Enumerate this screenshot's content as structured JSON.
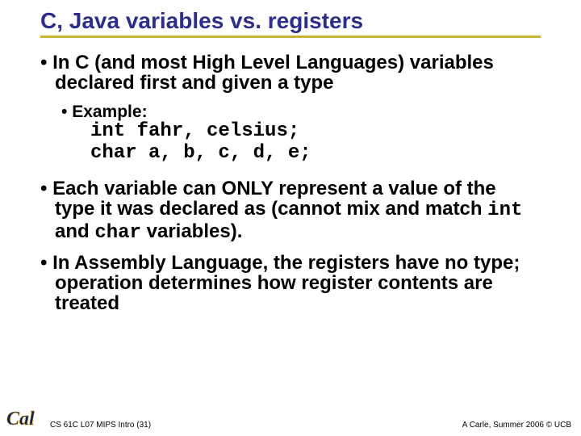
{
  "title": "C, Java variables vs. registers",
  "bullets": {
    "p1": "In C (and most High Level Languages) variables declared first and given a type",
    "example_label": "Example:",
    "code_line1": "int fahr, celsius;",
    "code_line2": "char a, b, c, d, e;",
    "p2_a": "Each variable can ONLY represent a value of the type it was declared as (cannot mix and match ",
    "p2_code1": "int",
    "p2_mid": " and ",
    "p2_code2": "char",
    "p2_b": " variables).",
    "p3": "In Assembly Language, the registers have no type; operation determines how register contents are treated"
  },
  "footer": {
    "left": "CS 61C L07 MIPS Intro (31)",
    "right": "A Carle, Summer 2006 © UCB"
  },
  "logo_text": "Cal"
}
